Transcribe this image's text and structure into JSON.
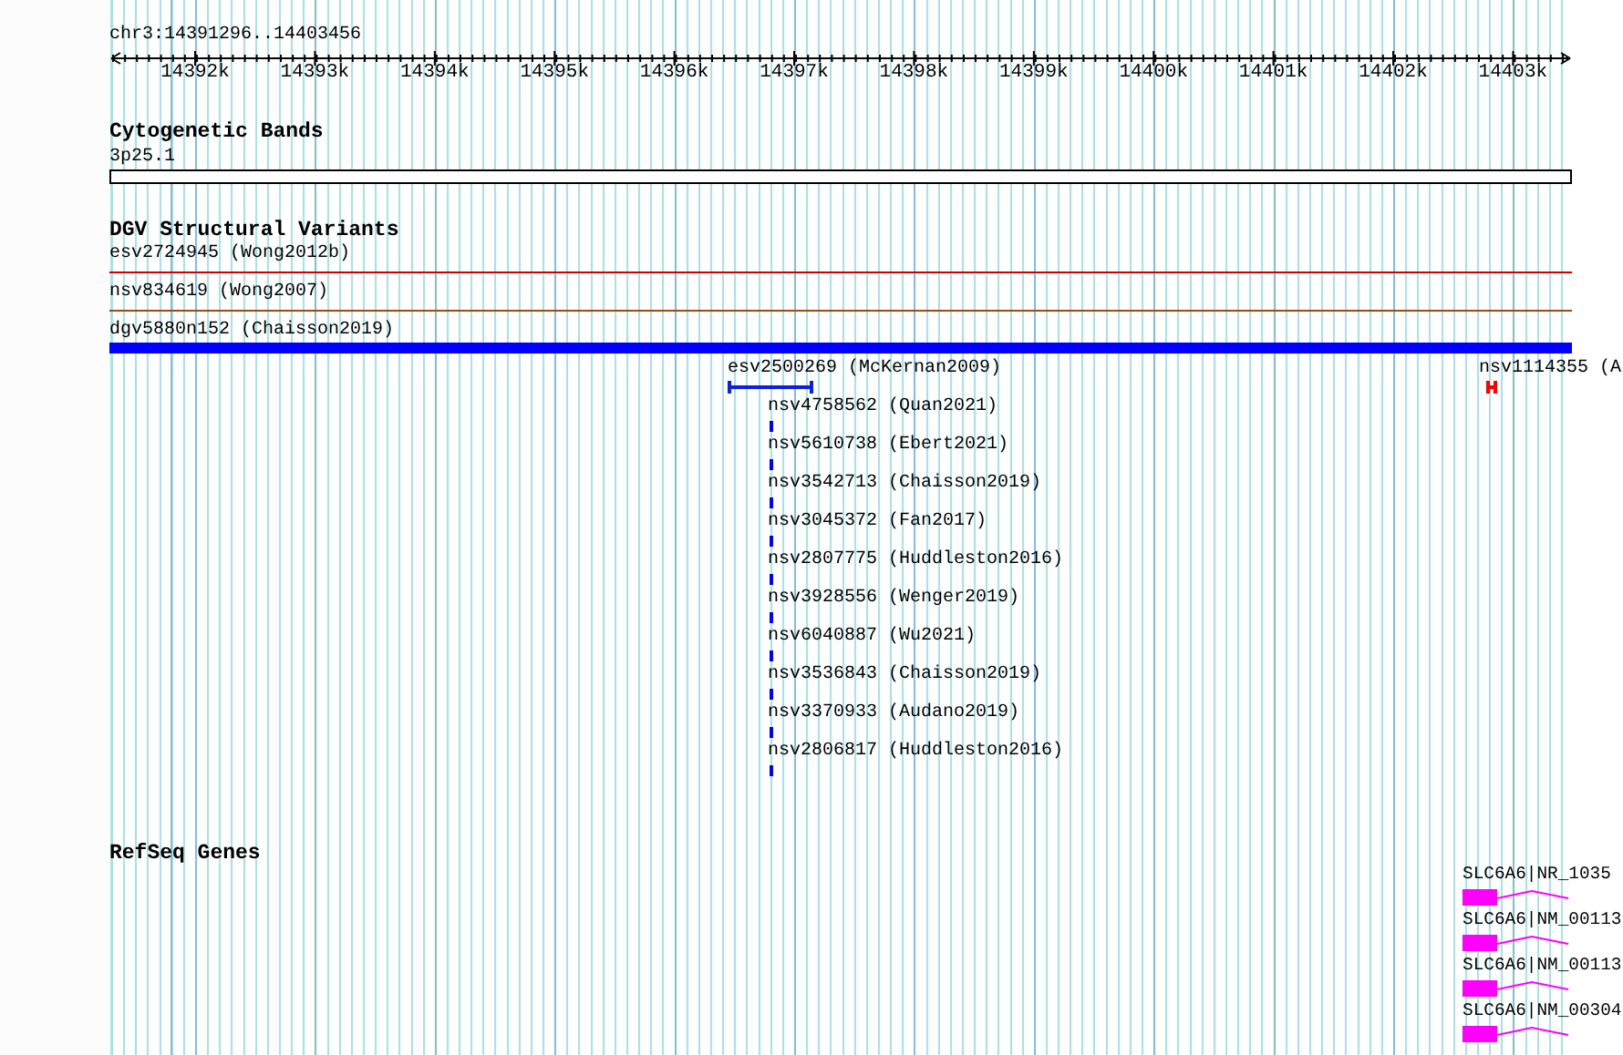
{
  "ruler": {
    "label": "chr3:14391296..14403456",
    "ticks": [
      "14392k",
      "14393k",
      "14394k",
      "14395k",
      "14396k",
      "14397k",
      "14398k",
      "14399k",
      "14400k",
      "14401k",
      "14402k",
      "14403k"
    ]
  },
  "tracks": [
    {
      "kind": "bands",
      "title": "Cytogenetic Bands",
      "features": [
        {
          "label": "3p25.1"
        }
      ]
    },
    {
      "kind": "variants",
      "title": "DGV Structural Variants",
      "features": [
        {
          "label": "esv2724945 (Wong2012b)",
          "color": "#d00000"
        },
        {
          "label": "nsv834619 (Wong2007)",
          "color": "#a04a10"
        },
        {
          "label": "dgv5880n152 (Chaisson2019)",
          "color": "#0000ff"
        },
        {
          "label": "esv2500269 (McKernan2009)",
          "color": "#1020e0"
        },
        {
          "label": "nsv4758562 (Quan2021)",
          "color": "#0000ff"
        },
        {
          "label": "nsv5610738 (Ebert2021)",
          "color": "#0000ff"
        },
        {
          "label": "nsv3542713 (Chaisson2019)",
          "color": "#0000ff"
        },
        {
          "label": "nsv3045372 (Fan2017)",
          "color": "#0000ff"
        },
        {
          "label": "nsv2807775 (Huddleston2016)",
          "color": "#0000ff"
        },
        {
          "label": "nsv3928556 (Wenger2019)",
          "color": "#0000ff"
        },
        {
          "label": "nsv6040887 (Wu2021)",
          "color": "#0000ff"
        },
        {
          "label": "nsv3536843 (Chaisson2019)",
          "color": "#0000ff"
        },
        {
          "label": "nsv3370933 (Audano2019)",
          "color": "#0000ff"
        },
        {
          "label": "nsv2806817 (Huddleston2016)",
          "color": "#0000ff"
        },
        {
          "label": "nsv1114355 (A",
          "color": "#ff0000"
        }
      ]
    },
    {
      "kind": "genes",
      "title": "RefSeq Genes",
      "features": [
        {
          "label": "SLC6A6|NR_1035"
        },
        {
          "label": "SLC6A6|NM_00113"
        },
        {
          "label": "SLC6A6|NM_00113"
        },
        {
          "label": "SLC6A6|NM_00304"
        }
      ]
    }
  ]
}
